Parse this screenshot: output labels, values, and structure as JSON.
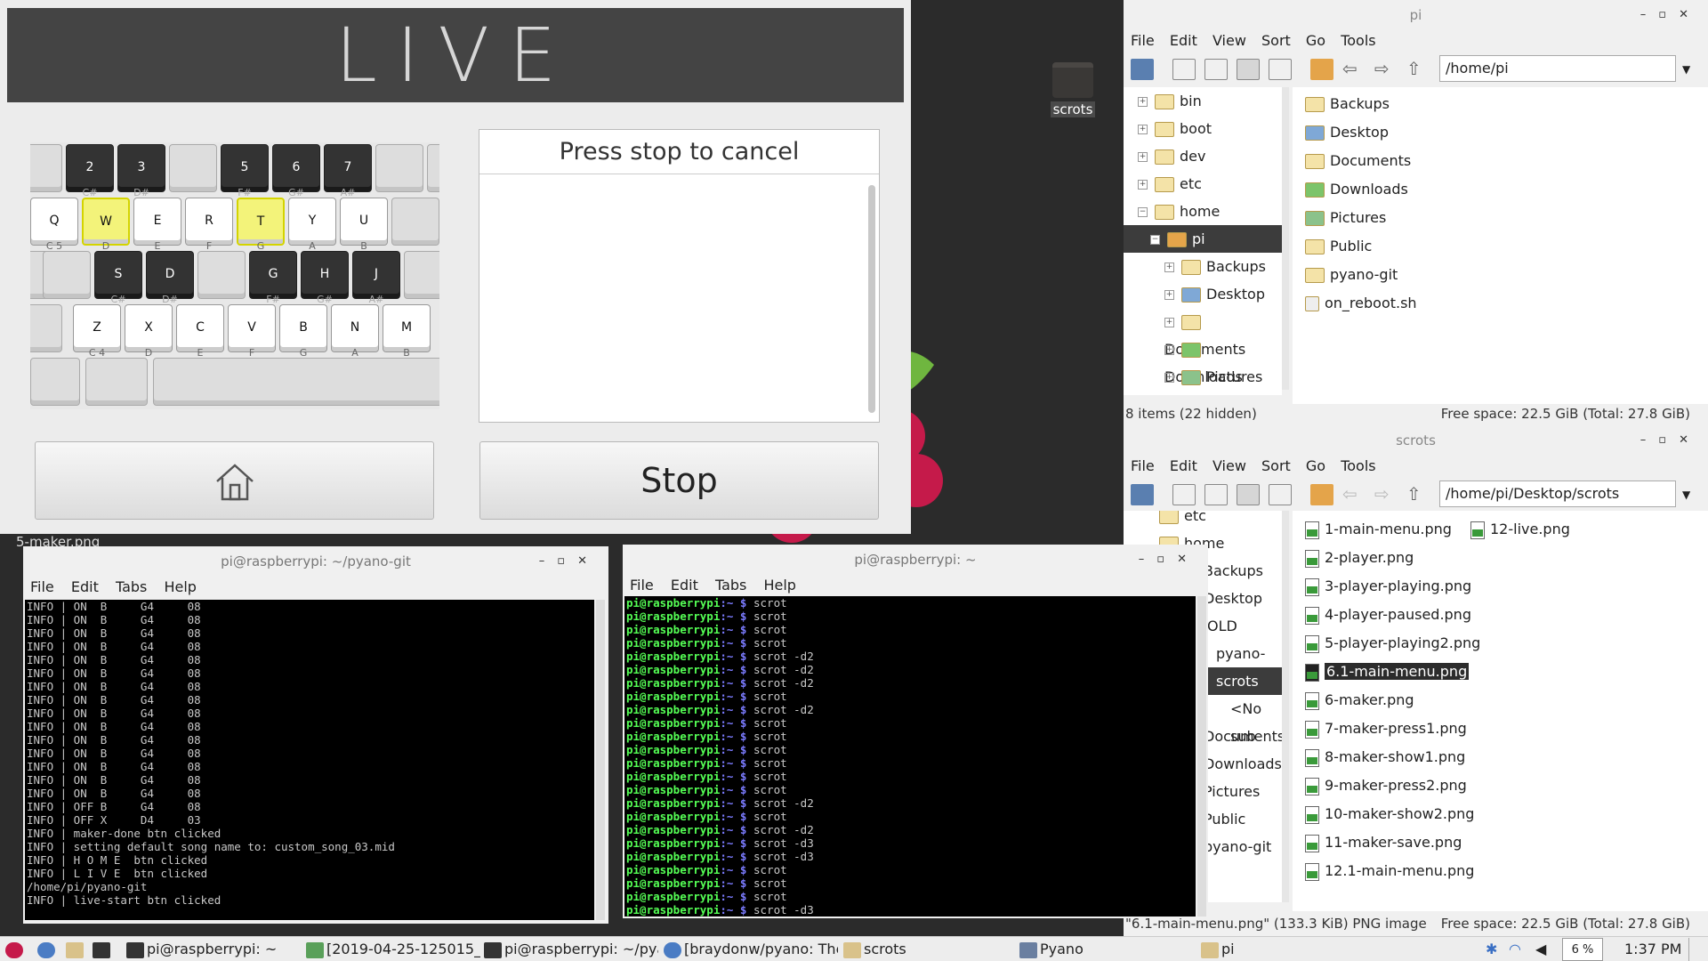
{
  "desktop": {
    "icon_label": "scrots",
    "partial_label": "5-maker.png"
  },
  "pyano": {
    "title": "LIVE",
    "cancel_header": "Press stop to cancel",
    "stop_label": "Stop",
    "keyboard": {
      "row1": [
        {
          "k": "2",
          "n": "C#"
        },
        {
          "k": "3",
          "n": "D#"
        },
        {
          "k": "5",
          "n": "F#"
        },
        {
          "k": "6",
          "n": "G#"
        },
        {
          "k": "7",
          "n": "A#"
        }
      ],
      "row2": [
        {
          "k": "Q",
          "n": "C 5"
        },
        {
          "k": "W",
          "n": "D"
        },
        {
          "k": "E",
          "n": "E"
        },
        {
          "k": "R",
          "n": "F"
        },
        {
          "k": "T",
          "n": "G"
        },
        {
          "k": "Y",
          "n": "A"
        },
        {
          "k": "U",
          "n": "B"
        }
      ],
      "row3": [
        {
          "k": "S",
          "n": "C#"
        },
        {
          "k": "D",
          "n": "D#"
        },
        {
          "k": "G",
          "n": "F#"
        },
        {
          "k": "H",
          "n": "G#"
        },
        {
          "k": "J",
          "n": "A#"
        }
      ],
      "row4": [
        {
          "k": "Z",
          "n": "C 4"
        },
        {
          "k": "X",
          "n": "D"
        },
        {
          "k": "C",
          "n": "E"
        },
        {
          "k": "V",
          "n": "F"
        },
        {
          "k": "B",
          "n": "G"
        },
        {
          "k": "N",
          "n": "A"
        },
        {
          "k": "M",
          "n": "B"
        }
      ]
    }
  },
  "fm_top": {
    "title": "pi",
    "menu": [
      "File",
      "Edit",
      "View",
      "Sort",
      "Go",
      "Tools"
    ],
    "path": "/home/pi",
    "tree": [
      {
        "label": "bin",
        "exp": "+"
      },
      {
        "label": "boot",
        "exp": "+"
      },
      {
        "label": "dev",
        "exp": "+"
      },
      {
        "label": "etc",
        "exp": "+"
      },
      {
        "label": "home",
        "exp": "−"
      },
      {
        "label": "pi",
        "exp": "−"
      },
      {
        "label": "Backups",
        "exp": "+"
      },
      {
        "label": "Desktop",
        "exp": "+"
      },
      {
        "label": "Documents",
        "exp": "+"
      },
      {
        "label": "Downloads",
        "exp": "+"
      },
      {
        "label": "Pictures",
        "exp": "+"
      }
    ],
    "items": [
      "Backups",
      "Desktop",
      "Documents",
      "Downloads",
      "Pictures",
      "Public",
      "pyano-git",
      "on_reboot.sh"
    ],
    "status_left": "8 items (22 hidden)",
    "status_right": "Free space: 22.5 GiB (Total: 27.8 GiB)"
  },
  "fm_bottom": {
    "title": "scrots",
    "menu": [
      "File",
      "Edit",
      "View",
      "Sort",
      "Go",
      "Tools"
    ],
    "path": "/home/pi/Desktop/scrots",
    "tree": [
      "etc",
      "home",
      "Backups",
      "Desktop",
      "OLD",
      "pyano-git",
      "scrots",
      "<No sub",
      "Documents",
      "Downloads",
      "Pictures",
      "Public",
      "pyano-git"
    ],
    "items_col1": [
      "1-main-menu.png",
      "2-player.png",
      "3-player-playing.png",
      "4-player-paused.png",
      "5-player-playing2.png",
      "6.1-main-menu.png",
      "6-maker.png",
      "7-maker-press1.png",
      "8-maker-show1.png",
      "9-maker-press2.png",
      "10-maker-show2.png",
      "11-maker-save.png",
      "12.1-main-menu.png"
    ],
    "items_col2": [
      "12-live.png"
    ],
    "selected": "6.1-main-menu.png",
    "status_left": "\"6.1-main-menu.png\" (133.3 KiB) PNG image",
    "status_right": "Free space: 22.5 GiB (Total: 27.8 GiB)"
  },
  "term1": {
    "title": "pi@raspberrypi: ~/pyano-git",
    "menu": [
      "File",
      "Edit",
      "Tabs",
      "Help"
    ],
    "lines": [
      "INFO | ON  B     G4     08",
      "INFO | ON  B     G4     08",
      "INFO | ON  B     G4     08",
      "INFO | ON  B     G4     08",
      "INFO | ON  B     G4     08",
      "INFO | ON  B     G4     08",
      "INFO | ON  B     G4     08",
      "INFO | ON  B     G4     08",
      "INFO | ON  B     G4     08",
      "INFO | ON  B     G4     08",
      "INFO | ON  B     G4     08",
      "INFO | ON  B     G4     08",
      "INFO | ON  B     G4     08",
      "INFO | ON  B     G4     08",
      "INFO | ON  B     G4     08",
      "INFO | OFF B     G4     08",
      "INFO | OFF X     D4     03",
      "INFO | maker-done btn clicked",
      "INFO | setting default song name to: custom_song_03.mid",
      "INFO | H O M E  btn clicked",
      "INFO | L I V E  btn clicked",
      "/home/pi/pyano-git",
      "INFO | live-start btn clicked"
    ]
  },
  "term2": {
    "title": "pi@raspberrypi: ~",
    "menu": [
      "File",
      "Edit",
      "Tabs",
      "Help"
    ],
    "prompt": "pi@raspberrypi",
    "cmds": [
      "scrot",
      "scrot",
      "scrot",
      "scrot",
      "scrot -d2",
      "scrot -d2",
      "scrot -d2",
      "scrot",
      "scrot -d2",
      "scrot",
      "scrot",
      "scrot",
      "scrot",
      "scrot",
      "scrot",
      "scrot -d2",
      "scrot",
      "scrot -d2",
      "scrot -d3",
      "scrot -d3",
      "scrot",
      "scrot",
      "scrot",
      "scrot -d3"
    ]
  },
  "taskbar": {
    "tasks": [
      "pi@raspberrypi: ~",
      "[2019-04-25-125015_1...",
      "pi@raspberrypi: ~/pya...",
      "[braydonw/pyano: The ...",
      "scrots",
      "Pyano",
      "pi"
    ],
    "cpu": "6 %",
    "clock": "1:37 PM"
  }
}
